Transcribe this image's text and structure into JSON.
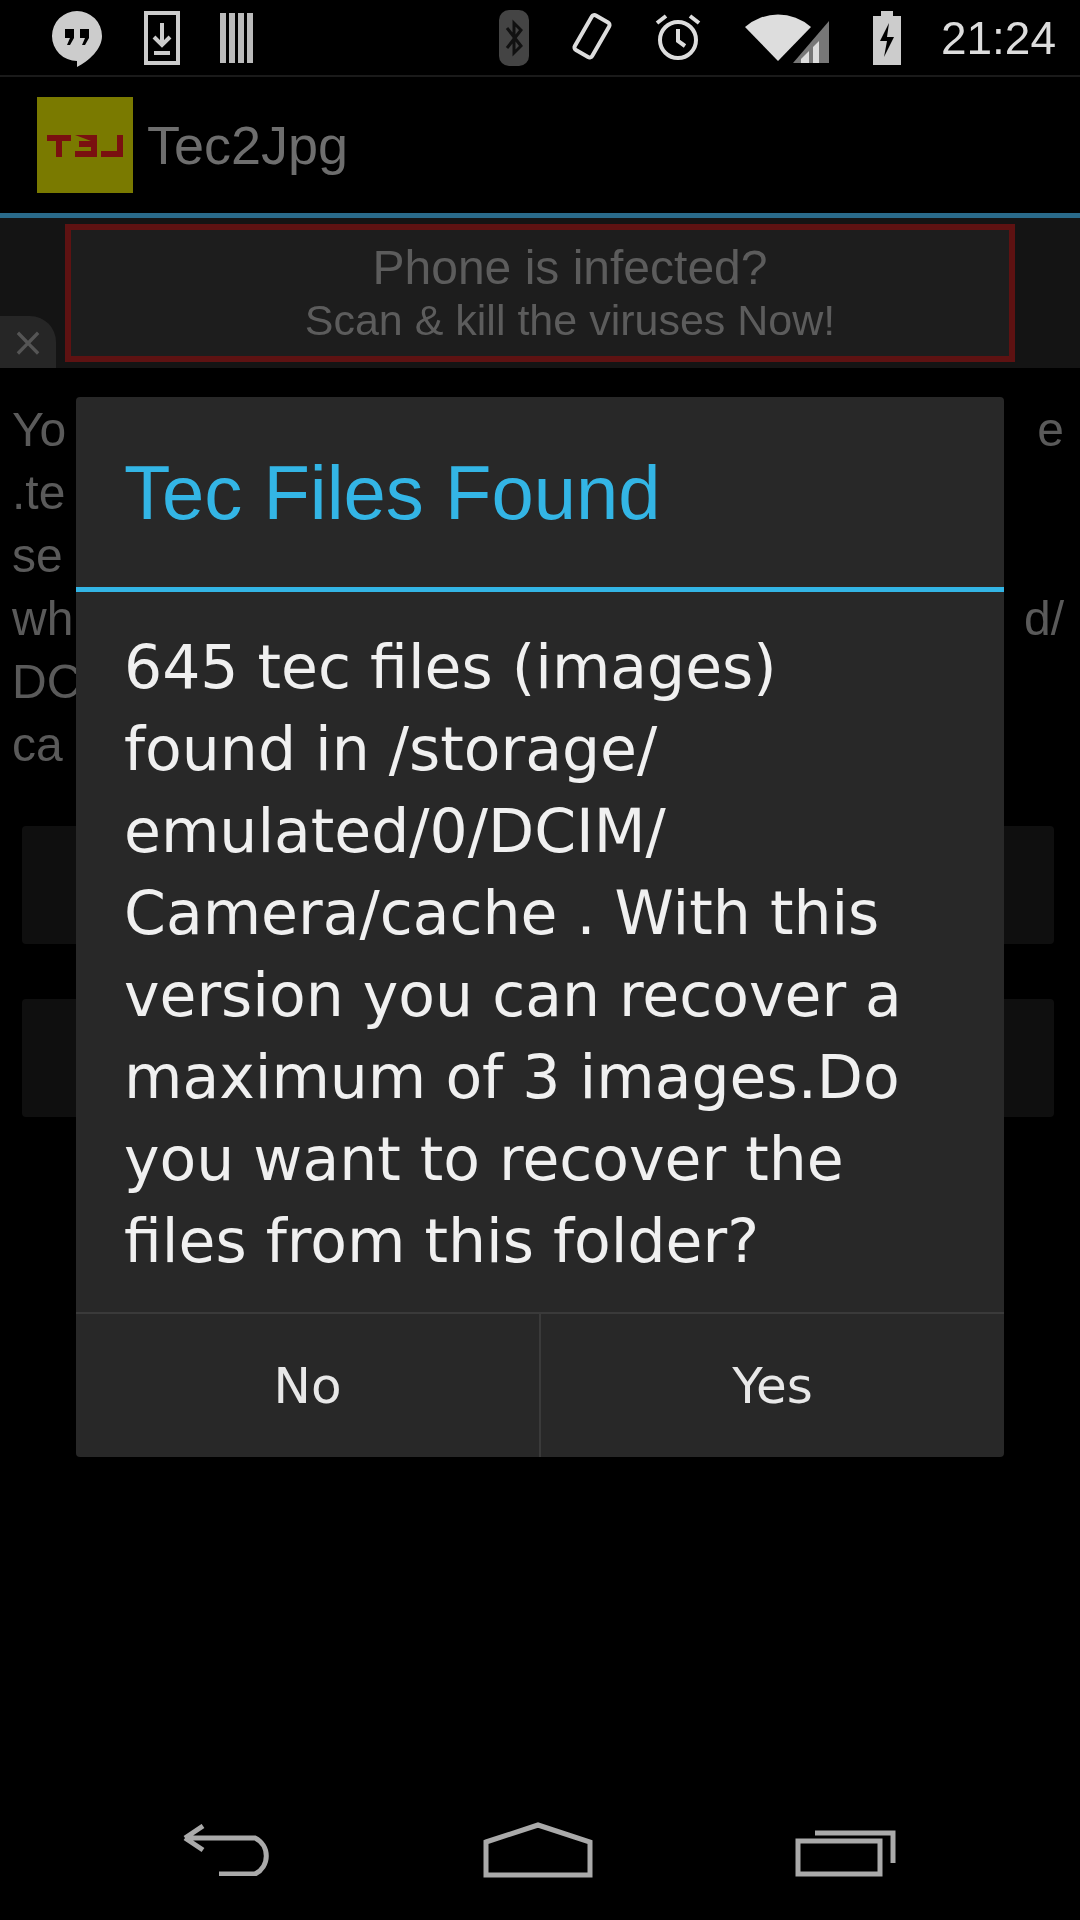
{
  "status_bar": {
    "time": "21:24"
  },
  "app_bar": {
    "title": "Tec2Jpg"
  },
  "ad_banner": {
    "headline": "Phone is infected?",
    "subline": "Scan & kill the viruses Now!",
    "close": "×"
  },
  "background_text": [
    {
      "left": "Yo",
      "right": "e"
    },
    {
      "left": ".te"
    },
    {
      "left": "se"
    },
    {
      "left": "wh",
      "right": "d/"
    },
    {
      "left": "DC"
    },
    {
      "left": "ca"
    }
  ],
  "background_buttons": [
    {
      "kind": "button"
    },
    {
      "kind": "button"
    }
  ],
  "dialog": {
    "title": "Tec Files Found",
    "message": "645 tec files (images) found in /storage/ emulated/0/DCIM/ Camera/cache . With this version you can recover a maximum of 3 images.Do you want to recover the files from this folder?",
    "buttons": [
      "No",
      "Yes"
    ]
  }
}
